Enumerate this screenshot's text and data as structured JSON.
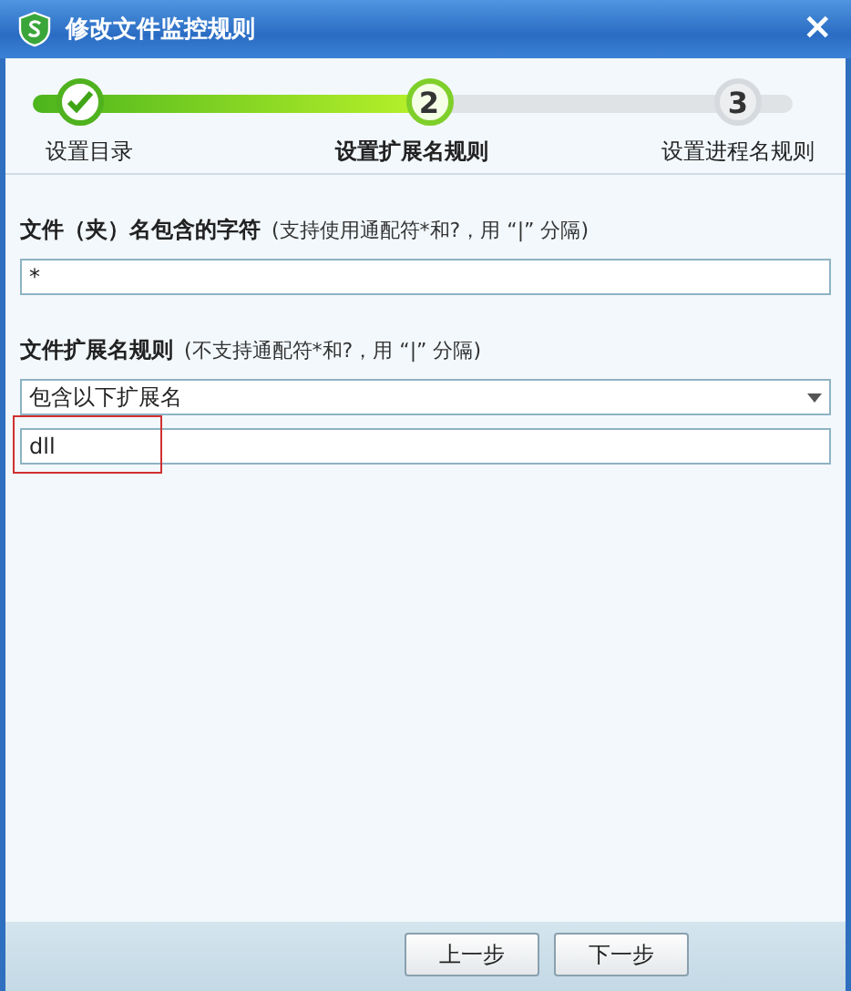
{
  "window": {
    "title": "修改文件监控规则",
    "close": "×"
  },
  "steps": [
    {
      "label": "设置目录",
      "done": true,
      "selected": false
    },
    {
      "label": "设置扩展名规则",
      "done": false,
      "selected": true,
      "number": "2"
    },
    {
      "label": "设置进程名规则",
      "done": false,
      "selected": false,
      "number": "3"
    }
  ],
  "name_rule": {
    "label": "文件（夹）名包含的字符",
    "hint": "(支持使用通配符*和?，用 “|” 分隔)",
    "value": "*"
  },
  "ext_rule": {
    "label": "文件扩展名规则",
    "hint": "(不支持通配符*和?，用 “|” 分隔)",
    "mode": "包含以下扩展名",
    "value": "dll",
    "highlighted": true
  },
  "buttons": [
    "上一步",
    "下一步"
  ]
}
